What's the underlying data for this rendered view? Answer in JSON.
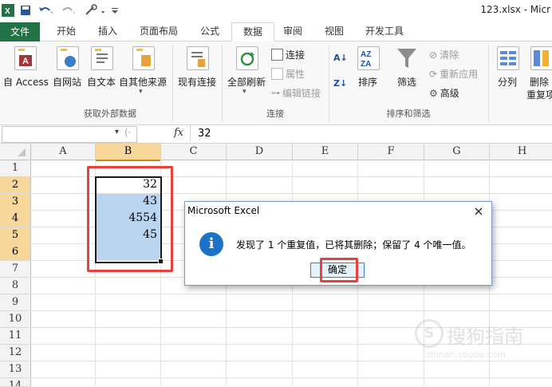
{
  "app": {
    "title": "123.xlsx - Micr"
  },
  "tabs": [
    {
      "label": "文件"
    },
    {
      "label": "开始"
    },
    {
      "label": "插入"
    },
    {
      "label": "页面布局"
    },
    {
      "label": "公式"
    },
    {
      "label": "数据"
    },
    {
      "label": "审阅"
    },
    {
      "label": "视图"
    },
    {
      "label": "开发工具"
    }
  ],
  "ribbon": {
    "get_external": {
      "buttons": [
        "自 Access",
        "自网站",
        "自文本",
        "自其他来源",
        "现有连接"
      ],
      "label": "获取外部数据"
    },
    "connections": {
      "refresh_all": "全部刷新",
      "connections": "连接",
      "properties": "属性",
      "edit_links": "编辑链接",
      "label": "连接"
    },
    "sort_filter": {
      "sort": "排序",
      "filter": "筛选",
      "clear": "清除",
      "reapply": "重新应用",
      "advanced": "高级",
      "label": "排序和筛选"
    },
    "tools": {
      "split": "分列",
      "remove": "删除",
      "remove_dup": "重复项"
    }
  },
  "formula_bar": {
    "fx": "fx",
    "value": "32"
  },
  "columns": [
    "A",
    "B",
    "C",
    "D",
    "E",
    "F",
    "G",
    "H"
  ],
  "rows": [
    "1",
    "2",
    "3",
    "4",
    "5",
    "6",
    "7",
    "8",
    "9",
    "10",
    "11",
    "12",
    "13",
    "14"
  ],
  "cells": {
    "B2": "32",
    "B3": "43",
    "B4": "4554",
    "B5": "45"
  },
  "dialog": {
    "title": "Microsoft Excel",
    "message": "发现了 1 个重复值，已将其删除；保留了 4 个唯一值。",
    "ok": "确定",
    "close": "×",
    "info_glyph": "i"
  },
  "watermark": {
    "text": "搜狗指南",
    "url": "zhinan.sogou.com"
  },
  "colors": {
    "file_tab": "#217346",
    "selection": "#b9d5f0",
    "highlight_red": "#e8413a",
    "info_blue": "#1a73c8"
  }
}
